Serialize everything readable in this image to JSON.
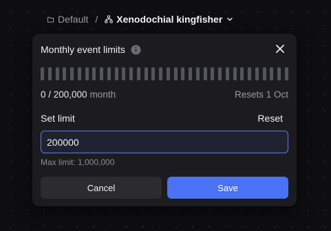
{
  "breadcrumb": {
    "workspace": {
      "label": "Default",
      "icon": "folder-icon"
    },
    "separator": "/",
    "project": {
      "label": "Xenodochial kingfisher",
      "icon": "network-icon",
      "dropdown_icon": "chevron-down-icon"
    }
  },
  "modal": {
    "title": "Monthly event limits",
    "info_icon": "info-icon",
    "close_icon": "close-icon",
    "meter": {
      "segments": 34,
      "filled_fraction": 0
    },
    "usage": {
      "current_of_limit": "0 / 200,000",
      "period": "month",
      "resets": "Resets 1 Oct"
    },
    "set_limit_label": "Set limit",
    "reset_label": "Reset",
    "limit_input": {
      "value": "200000"
    },
    "max_limit_text": "Max limit: 1,000,000",
    "cancel_label": "Cancel",
    "save_label": "Save"
  },
  "colors": {
    "accent": "#4a72f5",
    "modal_bg": "#1c1c20",
    "page_bg": "#0e0e10",
    "input_border": "#5b7fe6"
  }
}
